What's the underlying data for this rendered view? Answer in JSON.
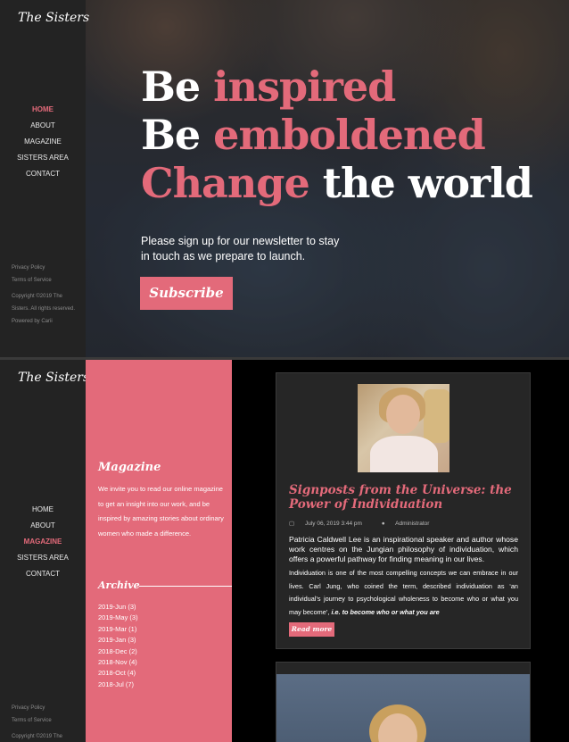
{
  "brand": {
    "logo": "The Sisters"
  },
  "nav": {
    "items": [
      "HOME",
      "ABOUT",
      "MAGAZINE",
      "SISTERS AREA",
      "CONTACT"
    ]
  },
  "footer_links": {
    "privacy": "Privacy Policy",
    "terms": "Terms of Service",
    "copyright": "Copyright ©2019 The Sisters. All rights reserved. Powered by Carii",
    "copyright_short": "Copyright ©2019 The"
  },
  "hero": {
    "line1_white": "Be",
    "line1_pink": "inspired",
    "line2_white": "Be",
    "line2_pink": "emboldened",
    "line3_pink": "Change",
    "line3_white": "the world",
    "text": "Please sign up for our newsletter to stay in touch as we prepare to launch.",
    "button": "Subscribe"
  },
  "magazine": {
    "title": "Magazine",
    "text": "We invite you to read our online magazine to get an insight into our work, and be inspired by amazing stories about ordinary women who made a difference.",
    "archive_title": "Archive",
    "archive": [
      "2019-Jun (3)",
      "2019-May (3)",
      "2019-Mar (1)",
      "2019-Jan (3)",
      "2018-Dec (2)",
      "2018-Nov (4)",
      "2018-Oct (4)",
      "2018-Jul (7)"
    ]
  },
  "post": {
    "title": "Signposts from the Universe: the Power of Individuation",
    "date": "July 06, 2019 3:44 pm",
    "author": "Administrator",
    "lead": "Patricia Caldwell Lee is an inspirational speaker and author whose work centres on the Jungian philosophy of individuation, which offers a powerful pathway for finding meaning in our lives.",
    "body": "Individuation is one of the most compelling concepts we can embrace in our lives. Carl Jung, who coined the term, described individuation as ‘an individual’s journey to psychological wholeness to become who or what you may become’,",
    "body_emphasis": "i.e. to become who or what you are",
    "read_more": "Read more"
  },
  "colors": {
    "accent": "#e36a7a",
    "sidebar": "#232323",
    "card": "#262626"
  }
}
